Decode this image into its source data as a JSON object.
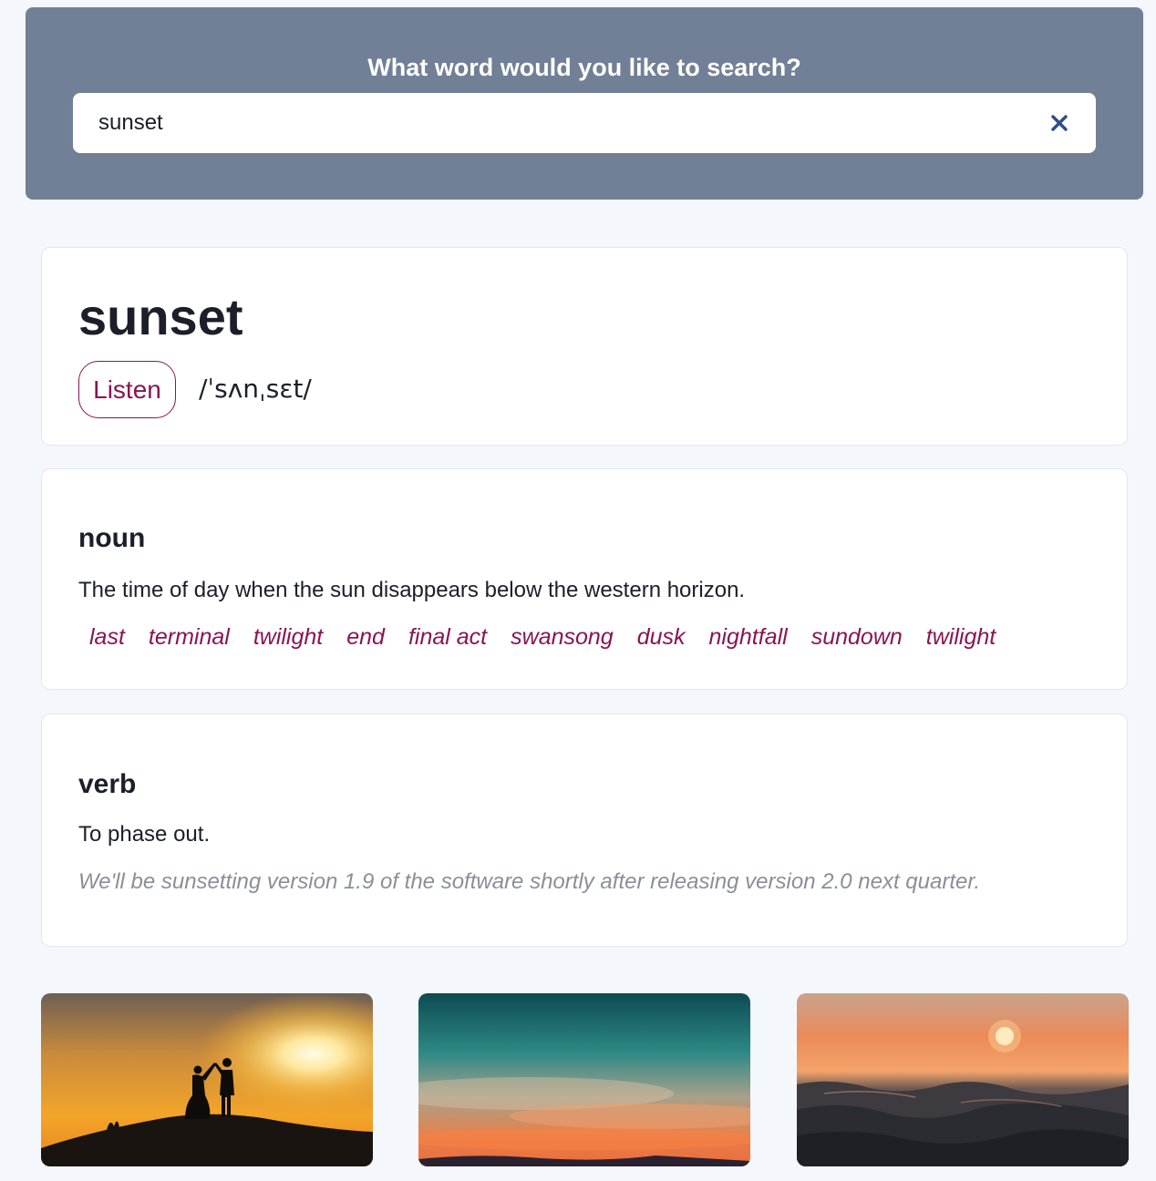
{
  "search": {
    "heading": "What word would you like to search?",
    "value": "sunset",
    "clear_icon": "close-icon"
  },
  "word": {
    "title": "sunset",
    "listen_label": "Listen",
    "phonetic": "/ˈsʌnˌsɛt/"
  },
  "meanings": [
    {
      "part_of_speech": "noun",
      "definition": "The time of day when the sun disappears below the western horizon.",
      "synonyms": [
        "last",
        "terminal",
        "twilight",
        "end",
        "final act",
        "swansong",
        "dusk",
        "nightfall",
        "sundown",
        "twilight"
      ]
    },
    {
      "part_of_speech": "verb",
      "definition": "To phase out.",
      "example": "We'll be sunsetting version 1.9 of the software shortly after releasing version 2.0 next quarter."
    }
  ],
  "photos": [
    {
      "subject": "couple-silhouette-sunset-photo"
    },
    {
      "subject": "teal-orange-sky-photo"
    },
    {
      "subject": "ocean-waves-sunset-photo"
    }
  ],
  "colors": {
    "panel": "#718096",
    "accent": "#8a1454",
    "clear_icon": "#2b4c8c",
    "background": "#f4f7fb"
  }
}
